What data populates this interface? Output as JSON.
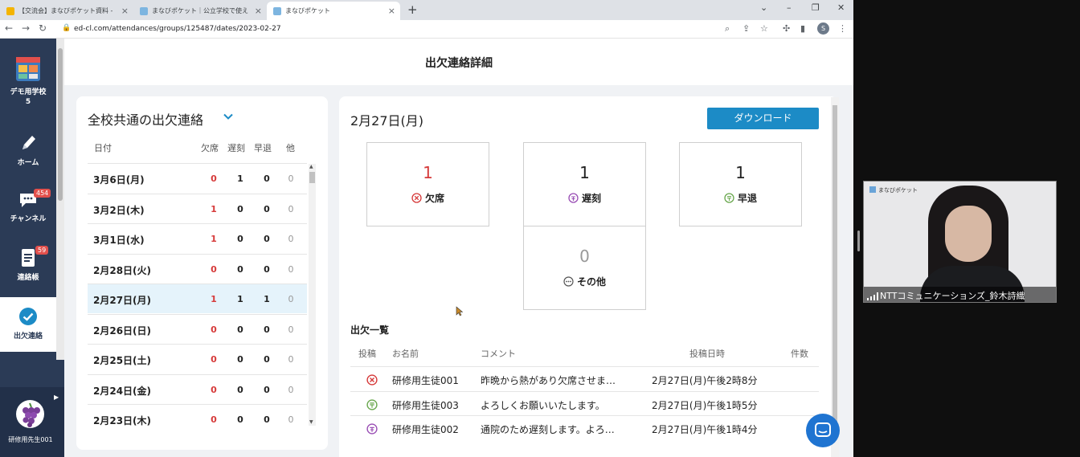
{
  "browser": {
    "tabs": [
      {
        "title": "【交流会】まなびポケット資料 - Goo...",
        "active": false
      },
      {
        "title": "まなびポケット｜公立学校で使える教...",
        "active": false
      },
      {
        "title": "まなびポケット",
        "active": true
      }
    ],
    "new_tab": "+",
    "url": "ed-cl.com/attendances/groups/125487/dates/2023-02-27",
    "profile_initial": "S"
  },
  "sidebar": {
    "school": "デモ用学校5",
    "items": [
      {
        "label": "ホーム",
        "badge": ""
      },
      {
        "label": "チャンネル",
        "badge": "454"
      },
      {
        "label": "連絡帳",
        "badge": "59"
      },
      {
        "label": "出欠連絡",
        "badge": ""
      }
    ],
    "user_name": "研修用先生001"
  },
  "page": {
    "title": "出欠連絡詳細"
  },
  "left_panel": {
    "group_title": "全校共通の出欠連絡",
    "columns": {
      "date": "日付",
      "absent": "欠席",
      "late": "遅刻",
      "early": "早退",
      "other": "他"
    },
    "rows": [
      {
        "date": "3月6日(月)",
        "absent": "0",
        "late": "1",
        "early": "0",
        "other": "0"
      },
      {
        "date": "3月2日(木)",
        "absent": "1",
        "late": "0",
        "early": "0",
        "other": "0"
      },
      {
        "date": "3月1日(水)",
        "absent": "1",
        "late": "0",
        "early": "0",
        "other": "0"
      },
      {
        "date": "2月28日(火)",
        "absent": "0",
        "late": "0",
        "early": "0",
        "other": "0"
      },
      {
        "date": "2月27日(月)",
        "absent": "1",
        "late": "1",
        "early": "1",
        "other": "0"
      },
      {
        "date": "2月26日(日)",
        "absent": "0",
        "late": "0",
        "early": "0",
        "other": "0"
      },
      {
        "date": "2月25日(土)",
        "absent": "0",
        "late": "0",
        "early": "0",
        "other": "0"
      },
      {
        "date": "2月24日(金)",
        "absent": "0",
        "late": "0",
        "early": "0",
        "other": "0"
      },
      {
        "date": "2月23日(木)",
        "absent": "0",
        "late": "0",
        "early": "0",
        "other": "0"
      }
    ]
  },
  "detail": {
    "date": "2月27日(月)",
    "download_label": "ダウンロード",
    "summary": {
      "absent": {
        "count": "1",
        "label": "欠席"
      },
      "late": {
        "count": "1",
        "label": "遅刻"
      },
      "early": {
        "count": "1",
        "label": "早退"
      },
      "other": {
        "count": "0",
        "label": "その他"
      }
    },
    "list_title": "出欠一覧",
    "list_columns": {
      "type": "投稿",
      "name": "お名前",
      "comment": "コメント",
      "posted": "投稿日時",
      "count": "件数"
    },
    "list_rows": [
      {
        "type": "absent",
        "name": "研修用生徒001",
        "comment": "昨晩から熱があり欠席させま…",
        "posted": "2月27日(月)午後2時8分"
      },
      {
        "type": "early",
        "name": "研修用生徒003",
        "comment": "よろしくお願いいたします。",
        "posted": "2月27日(月)午後1時5分"
      },
      {
        "type": "late",
        "name": "研修用生徒002",
        "comment": "通院のため遅刻します。よろ…",
        "posted": "2月27日(月)午後1時4分"
      }
    ]
  },
  "video": {
    "logo_text": "まなびポケット",
    "participant": "NTTコミュニケーションズ_鈴木詩織"
  },
  "colors": {
    "sidebar": "#2b3b56",
    "accent": "#1c8bc6",
    "absent": "#d63a3a",
    "selected_row": "#e5f3fb"
  }
}
